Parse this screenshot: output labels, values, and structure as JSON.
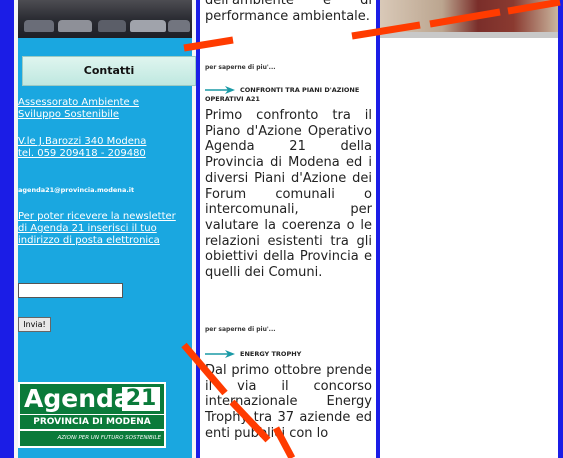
{
  "left": {
    "contatti_title": "Contatti",
    "assessorato": "Assessorato Ambiente e Sviluppo Sostenibile",
    "address_line1": "V.le J.Barozzi 340 Modena",
    "address_line2": "tel. 059 209418 - 209480",
    "email": "agenda21@provincia.modena.it",
    "newsletter": "Per poter ricevere la newsletter di Agenda 21 inserisci il tuo indirizzo di posta elettronica",
    "email_input_value": "",
    "submit_label": "Invia!",
    "logo": {
      "word": "Agenda",
      "number": "21",
      "provincia": "PROVINCIA DI MODENA",
      "tagline": "AZIONI PER UN FUTURO SOSTENIBILE"
    }
  },
  "middle": {
    "p1_partial": "dell'ambiente e di performance ambientale.",
    "more1": "per saperne di piu'...",
    "head2": "CONFRONTI TRA PIANI D'AZIONE OPERATIVI A21",
    "p2": "Primo confronto tra il Piano d'Azione Operativo Agenda 21 della Provincia di Modena ed i diversi Piani d'Azione dei Forum comunali o intercomunali, per valutare la coerenza o le relazioni esistenti tra gli obiettivi della Provincia e quelli dei Comuni.",
    "more2": "per saperne di piu'...",
    "head3": "ENERGY TROPHY",
    "p3": "Dal primo ottobre prende il via il concorso internazionale Energy Trophy tra 37 aziende ed enti pubblici con lo"
  },
  "colors": {
    "page_bg": "#1b1de6",
    "left_panel": "#1aa7e0",
    "accent_arrow": "#1a9aa6",
    "overlay_line": "#ff3b00",
    "logo_green": "#0a7a3a"
  }
}
